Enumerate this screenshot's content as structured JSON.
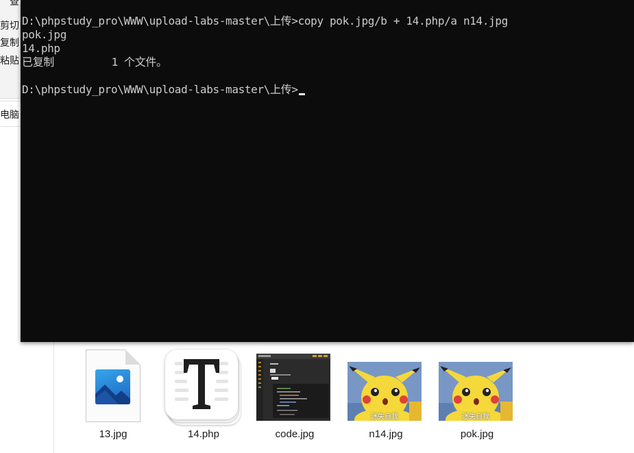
{
  "ribbon": {
    "top_fragment": "查",
    "cut_label": "剪切",
    "copy_label": "复制",
    "paste_label": "粘贴"
  },
  "nav": {
    "this_pc_label": "电脑"
  },
  "console": {
    "lines": [
      "D:\\phpstudy_pro\\WWW\\upload-labs-master\\上传>copy pok.jpg/b + 14.php/a n14.jpg",
      "pok.jpg",
      "14.php",
      "已复制         1 个文件。",
      "",
      "D:\\phpstudy_pro\\WWW\\upload-labs-master\\上传>"
    ]
  },
  "files": [
    {
      "name": "13.jpg",
      "icon": "image-file-icon"
    },
    {
      "name": "14.php",
      "icon": "typora-app-icon"
    },
    {
      "name": "code.jpg",
      "icon": "code-screenshot-thumbnail"
    },
    {
      "name": "n14.jpg",
      "icon": "pikachu-thumbnail",
      "caption": "迷失自我"
    },
    {
      "name": "pok.jpg",
      "icon": "pikachu-thumbnail",
      "caption": "迷失自我"
    }
  ],
  "colors": {
    "console_bg": "#0c0c0c",
    "console_text": "#cccccc",
    "pikachu_yellow": "#f5d83a",
    "thumb_bg_blue": "#6f8fc0"
  }
}
